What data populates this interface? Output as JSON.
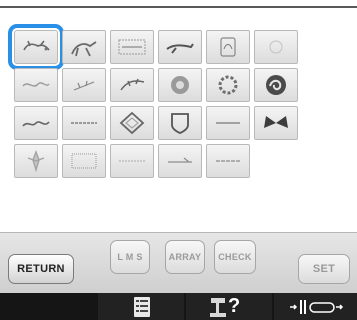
{
  "patterns": [
    {
      "row": 0,
      "col": 0,
      "icon": "dog-pattern-icon",
      "selected": true
    },
    {
      "row": 0,
      "col": 1,
      "icon": "horse-pattern-icon",
      "selected": false
    },
    {
      "row": 0,
      "col": 2,
      "icon": "floral-band-pattern-icon",
      "selected": false
    },
    {
      "row": 0,
      "col": 3,
      "icon": "bird-pattern-icon",
      "selected": false
    },
    {
      "row": 0,
      "col": 4,
      "icon": "deer-pattern-icon",
      "selected": false
    },
    {
      "row": 0,
      "col": 5,
      "icon": "faint-motif-pattern-icon",
      "selected": false
    },
    {
      "row": 1,
      "col": 0,
      "icon": "vine-pattern-icon",
      "selected": false
    },
    {
      "row": 1,
      "col": 1,
      "icon": "sprig-pattern-icon",
      "selected": false
    },
    {
      "row": 1,
      "col": 2,
      "icon": "leaf-pattern-icon",
      "selected": false
    },
    {
      "row": 1,
      "col": 3,
      "icon": "medallion-pattern-icon",
      "selected": false
    },
    {
      "row": 1,
      "col": 4,
      "icon": "wreath-pattern-icon",
      "selected": false
    },
    {
      "row": 1,
      "col": 5,
      "icon": "swirl-pattern-icon",
      "selected": false
    },
    {
      "row": 2,
      "col": 0,
      "icon": "scroll-pattern-icon",
      "selected": false
    },
    {
      "row": 2,
      "col": 1,
      "icon": "border-pattern-icon",
      "selected": false
    },
    {
      "row": 2,
      "col": 2,
      "icon": "diamond-pattern-icon",
      "selected": false
    },
    {
      "row": 2,
      "col": 3,
      "icon": "crest-pattern-icon",
      "selected": false
    },
    {
      "row": 2,
      "col": 4,
      "icon": "line-pattern-icon",
      "selected": false
    },
    {
      "row": 2,
      "col": 5,
      "icon": "butterfly-pattern-icon",
      "selected": false
    },
    {
      "row": 3,
      "col": 0,
      "icon": "fleur-de-lis-pattern-icon",
      "selected": false
    },
    {
      "row": 3,
      "col": 1,
      "icon": "lace-pattern-icon",
      "selected": false
    },
    {
      "row": 3,
      "col": 2,
      "icon": "thin-border-pattern-icon",
      "selected": false
    },
    {
      "row": 3,
      "col": 3,
      "icon": "arrow-border-pattern-icon",
      "selected": false
    },
    {
      "row": 3,
      "col": 4,
      "icon": "dash-border-pattern-icon",
      "selected": false
    }
  ],
  "buttons": {
    "return": "RETURN",
    "lms": "L M S",
    "array": "ARRAY",
    "check": "CHECK",
    "set": "SET"
  },
  "bottom_bar": {
    "help_symbol": "?",
    "icons": [
      "settings-list-icon",
      "sewing-machine-help-icon",
      "thread-bobbin-icon"
    ]
  },
  "colors": {
    "selection": "#2a8fe6",
    "bottom_bar": "#151515"
  }
}
